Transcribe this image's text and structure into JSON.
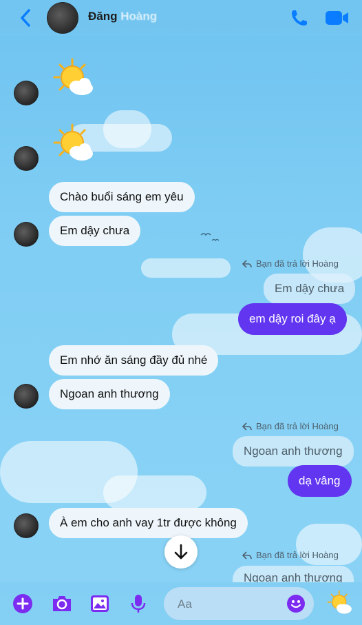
{
  "header": {
    "contact_name": "Đăng",
    "contact_name_blurred": "Hoàng"
  },
  "messages": {
    "in_1": "Chào buổi sáng em yêu",
    "in_2": "Em dậy chưa",
    "reply_note": "Bạn đã trả lời Hoàng",
    "quote_1": "Em dậy chưa",
    "out_1": "em dậy roi đây ạ",
    "in_3": "Em nhớ ăn sáng đầy đủ nhé",
    "in_4": "Ngoan anh thương",
    "quote_2": "Ngoan anh thương",
    "out_2": "dạ vâng",
    "in_5": "À em cho anh vay 1tr được không",
    "quote_3": "Ngoan anh thương"
  },
  "composer": {
    "placeholder": "Aa"
  },
  "colors": {
    "accent": "#0a7cff",
    "outgoing": "#6236f0",
    "toolbar_icons": "#7b2cf0"
  }
}
